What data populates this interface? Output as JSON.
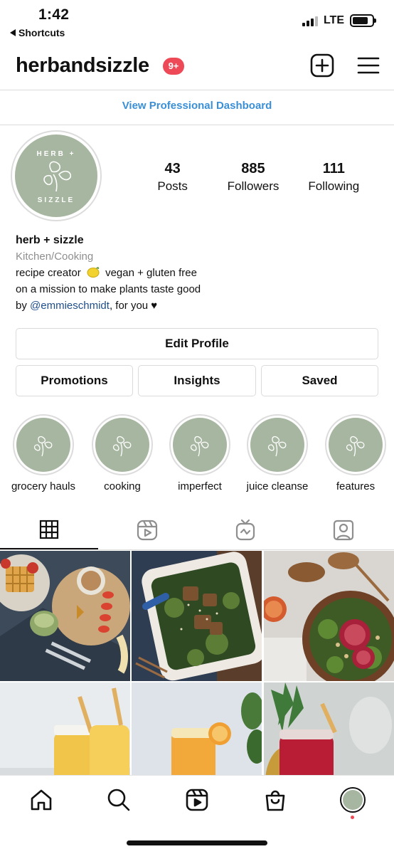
{
  "status_bar": {
    "time": "1:42",
    "back_label": "Shortcuts",
    "network": "LTE"
  },
  "header": {
    "username": "herbandsizzle",
    "notification_badge": "9+"
  },
  "pro_dashboard_link": "View Professional Dashboard",
  "profile": {
    "avatar_logo_top": "HERB +",
    "avatar_logo_bottom": "SIZZLE",
    "stats": [
      {
        "value": "43",
        "label": "Posts"
      },
      {
        "value": "885",
        "label": "Followers"
      },
      {
        "value": "111",
        "label": "Following"
      }
    ],
    "display_name": "herb + sizzle",
    "category": "Kitchen/Cooking",
    "bio_line1_a": "recipe creator",
    "bio_line1_b": "vegan + gluten free",
    "bio_line2": "on a mission to make plants taste good",
    "bio_line3_a": "by",
    "bio_mention": "@emmieschmidt",
    "bio_line3_b": ", for you ♥"
  },
  "buttons": {
    "edit_profile": "Edit Profile",
    "promotions": "Promotions",
    "insights": "Insights",
    "saved": "Saved"
  },
  "highlights": [
    {
      "label": "grocery hauls"
    },
    {
      "label": "cooking"
    },
    {
      "label": "imperfect"
    },
    {
      "label": "juice cleanse"
    },
    {
      "label": "features"
    }
  ],
  "tabs": [
    "grid-icon",
    "reels-icon",
    "igtv-icon",
    "tagged-icon"
  ],
  "bottom_nav": [
    "home-icon",
    "search-icon",
    "reels-icon",
    "shop-icon",
    "profile-avatar"
  ],
  "colors": {
    "accent_link": "#3a8fd6",
    "badge": "#ed4956",
    "brand_sage": "#a7b6a0",
    "mention": "#1f4e8c"
  }
}
